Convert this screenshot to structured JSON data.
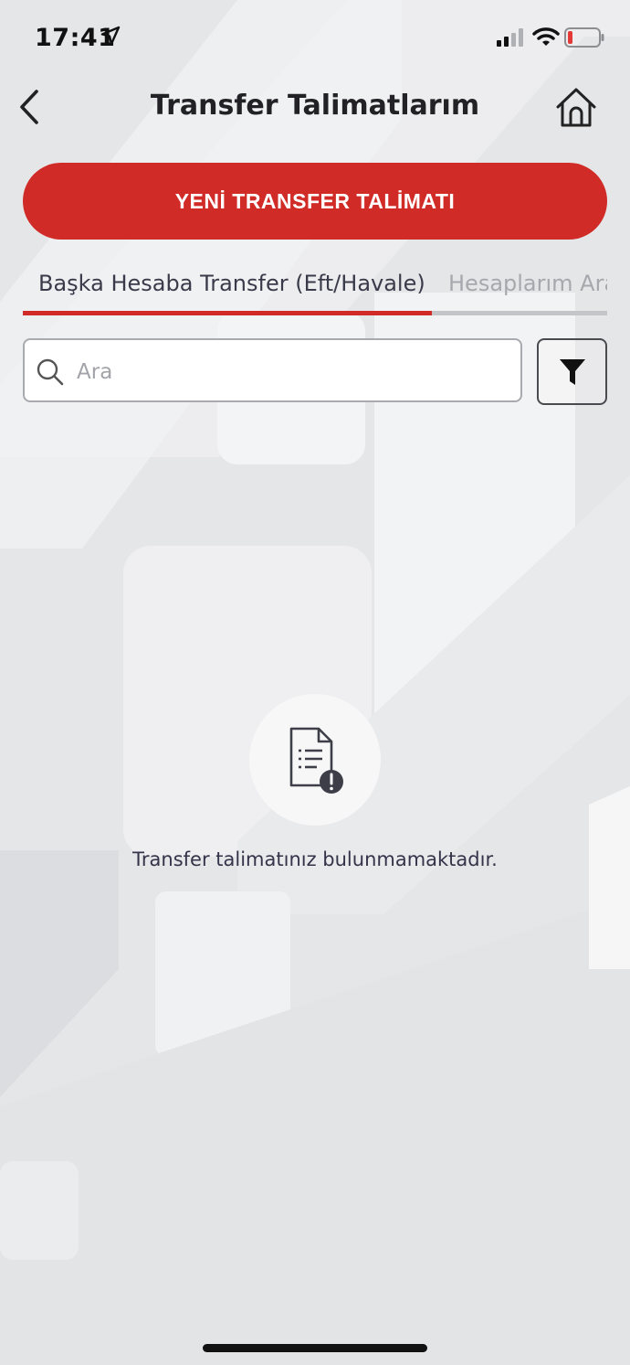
{
  "status_bar": {
    "time": "17:41",
    "icons": [
      "location-arrow-icon",
      "cellular-signal-icon",
      "wifi-icon",
      "battery-low-icon"
    ]
  },
  "header": {
    "title": "Transfer Talimatlarım",
    "back_icon": "chevron-left-icon",
    "home_icon": "home-icon"
  },
  "primary_button": {
    "label": "YENİ TRANSFER TALİMATI",
    "color": "#d12b28"
  },
  "tabs": [
    {
      "label": "Başka Hesaba Transfer (Eft/Havale)",
      "active": true
    },
    {
      "label": "Hesaplarım Arası",
      "active": false
    }
  ],
  "search": {
    "placeholder": "Ara",
    "value": ""
  },
  "filter": {
    "icon": "funnel-icon"
  },
  "empty_state": {
    "icon": "document-warning-icon",
    "message": "Transfer talimatınız bulunmamaktadır."
  },
  "colors": {
    "accent": "#d12b28",
    "background": "#e6e7e9",
    "text": "#2b2b2e"
  }
}
